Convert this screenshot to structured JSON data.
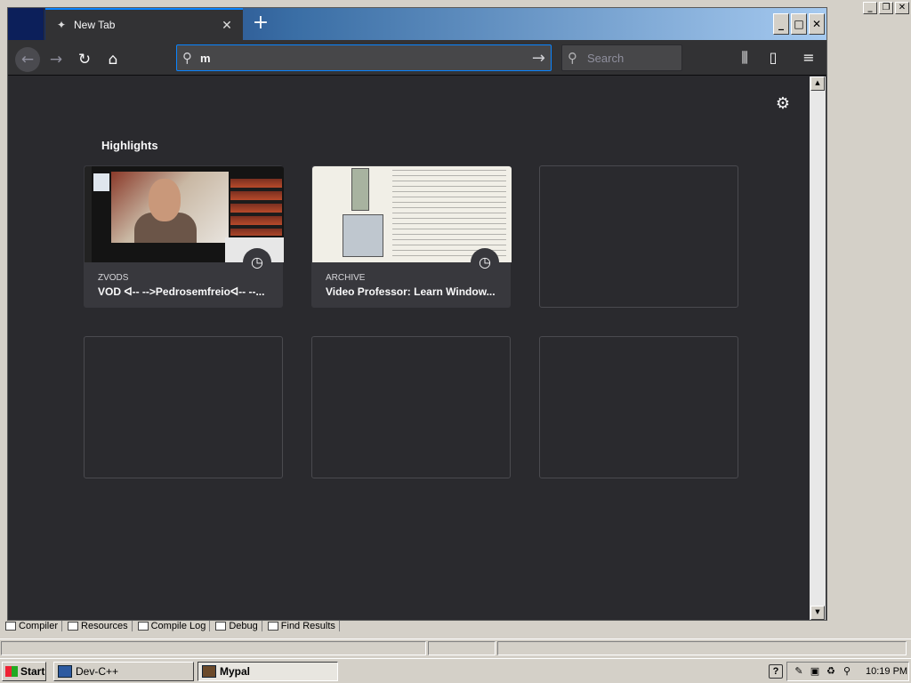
{
  "browser": {
    "tab": {
      "title": "New Tab"
    },
    "urlbar": {
      "value": "m"
    },
    "searchbar": {
      "placeholder": "Search"
    },
    "icons": {
      "back": "arrow-left-icon",
      "forward": "arrow-right-icon",
      "reload": "reload-icon",
      "home": "home-icon",
      "search": "search-icon",
      "go": "arrow-right-icon",
      "library": "library-icon",
      "sidebar": "sidebar-icon",
      "menu": "hamburger-menu-icon",
      "gear": "gear-icon",
      "clock": "clock-icon"
    }
  },
  "newtab": {
    "section_title": "Highlights",
    "cards": [
      {
        "source": "ZVODS",
        "title": "VOD ᐊ-- -->Pedrosemfreioᐊ-- --..."
      },
      {
        "source": "ARCHIVE",
        "title": "Video Professor: Learn Window..."
      }
    ]
  },
  "devcpp": {
    "bottom_tabs": [
      "Compiler",
      "Resources",
      "Compile Log",
      "Debug",
      "Find Results"
    ]
  },
  "taskbar": {
    "start_label": "Start",
    "items": [
      {
        "label": "Dev-C++"
      },
      {
        "label": "Mypal"
      }
    ],
    "help": "?",
    "clock": "10:19 PM"
  },
  "colors": {
    "accent": "#0a84ff",
    "content_bg": "#2a2a2e",
    "toolbar_bg": "#323234",
    "card_bg": "#38383d"
  }
}
